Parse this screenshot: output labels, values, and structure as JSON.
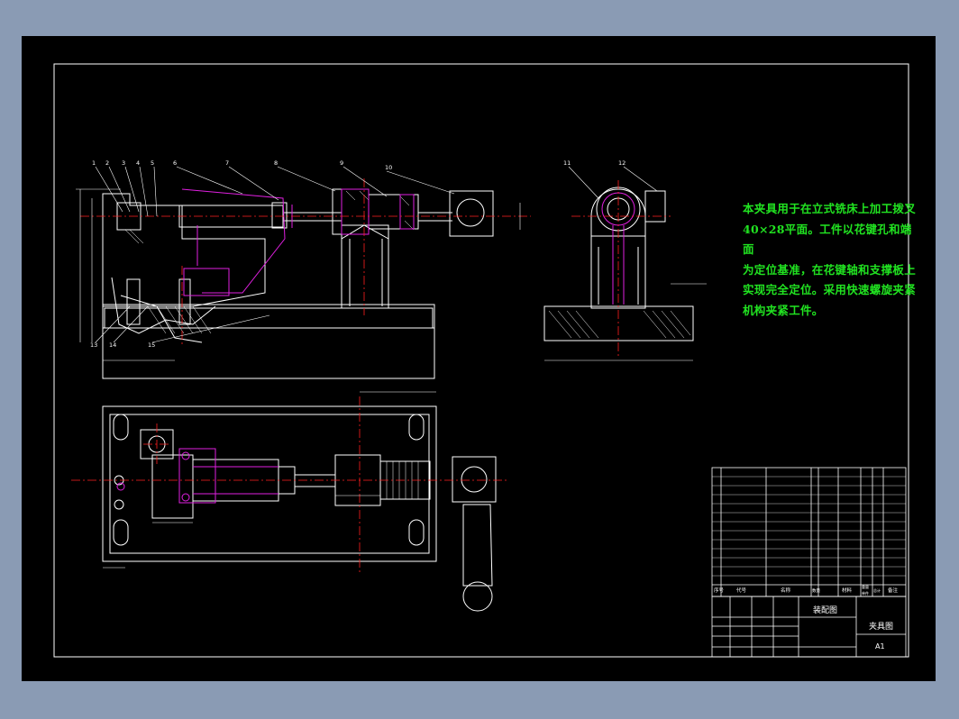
{
  "note": {
    "line1": "本夹具用于在立式铣床上加工拨叉",
    "line2": "40×28平面。工件以花键孔和端面",
    "line3": "为定位基准，在花键轴和支撑板上",
    "line4": "实现完全定位。采用快速螺旋夹紧",
    "line5": "机构夹紧工件。"
  },
  "balloons_front": [
    "1",
    "2",
    "3",
    "4",
    "5",
    "6",
    "7",
    "8",
    "9",
    "10"
  ],
  "balloons_side": [
    "11",
    "12"
  ],
  "balloons_bottom": [
    "13",
    "14",
    "15"
  ],
  "title_block": {
    "drawing_name": "装配图",
    "part_name": "夹具图",
    "sheet_size": "A1",
    "headers": [
      "序号",
      "代号",
      "名称",
      "数量",
      "材料",
      "单件",
      "总计",
      "备注"
    ],
    "weight_header": "重量"
  },
  "colors": {
    "outline": "#ffffff",
    "centerline": "#ff2020",
    "hidden": "#e020e0",
    "note_text": "#21e321",
    "frame_outer": "#8a9bb4",
    "sheet": "#000000"
  }
}
